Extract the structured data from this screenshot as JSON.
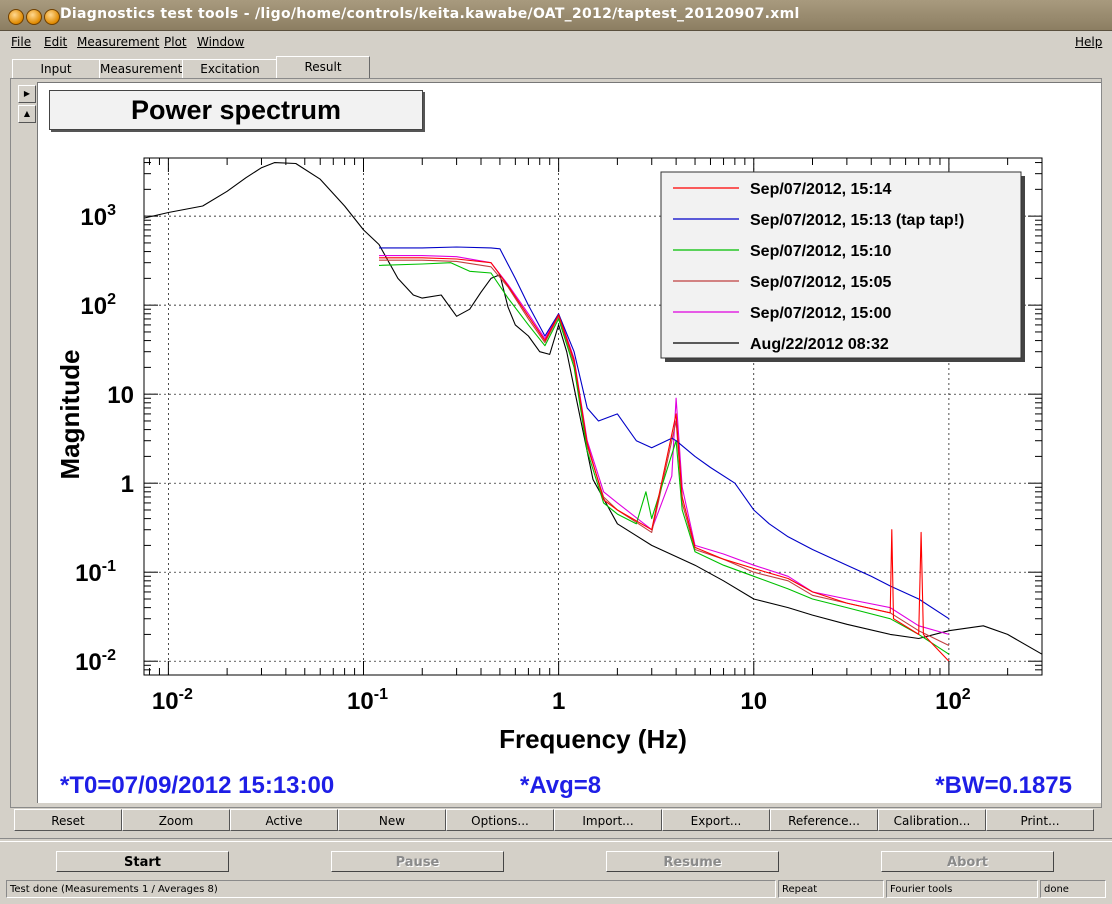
{
  "window": {
    "title": "Diagnostics test tools - /ligo/home/controls/keita.kawabe/OAT_2012/taptest_20120907.xml"
  },
  "menu": {
    "file": "File",
    "edit": "Edit",
    "measurement": "Measurement",
    "plot": "Plot",
    "window": "Window",
    "help": "Help"
  },
  "tabs": [
    "Input",
    "Measurement",
    "Excitation",
    "Result"
  ],
  "active_tab": "Result",
  "plot": {
    "title": "Power spectrum",
    "t0": "*T0=07/09/2012 15:13:00",
    "avg": "*Avg=8",
    "bw": "*BW=0.1875",
    "legend": [
      {
        "label": "Sep/07/2012, 15:14",
        "color": "#ff0000"
      },
      {
        "label": "Sep/07/2012, 15:13 (tap tap!)",
        "color": "#0000c8"
      },
      {
        "label": "Sep/07/2012, 15:10",
        "color": "#00c000"
      },
      {
        "label": "Sep/07/2012, 15:05",
        "color": "#c04040"
      },
      {
        "label": "Sep/07/2012, 15:00",
        "color": "#e000e0"
      },
      {
        "label": "Aug/22/2012 08:32",
        "color": "#000000"
      }
    ]
  },
  "chart_data": {
    "type": "line",
    "title": "Power spectrum",
    "xlabel": "Frequency (Hz)",
    "ylabel": "Magnitude",
    "xscale": "log",
    "yscale": "log",
    "xlim": [
      0.0075,
      300
    ],
    "ylim": [
      0.007,
      4500
    ],
    "grid": true,
    "legend_position": "top-right",
    "x_ticks": [
      {
        "v": 0.01,
        "base": "10",
        "exp": "-2"
      },
      {
        "v": 0.1,
        "base": "10",
        "exp": "-1"
      },
      {
        "v": 1,
        "base": "1",
        "exp": ""
      },
      {
        "v": 10,
        "base": "10",
        "exp": ""
      },
      {
        "v": 100,
        "base": "10",
        "exp": "2"
      }
    ],
    "y_ticks": [
      {
        "v": 0.01,
        "base": "10",
        "exp": "-2"
      },
      {
        "v": 0.1,
        "base": "10",
        "exp": "-1"
      },
      {
        "v": 1,
        "base": "1",
        "exp": ""
      },
      {
        "v": 10,
        "base": "10",
        "exp": ""
      },
      {
        "v": 100,
        "base": "10",
        "exp": "2"
      },
      {
        "v": 1000,
        "base": "10",
        "exp": "3"
      }
    ],
    "series": [
      {
        "name": "Aug/22/2012 08:32",
        "color": "#000000",
        "points": [
          [
            0.0075,
            950
          ],
          [
            0.01,
            1100
          ],
          [
            0.015,
            1300
          ],
          [
            0.02,
            1900
          ],
          [
            0.025,
            2700
          ],
          [
            0.03,
            3500
          ],
          [
            0.035,
            4000
          ],
          [
            0.045,
            3900
          ],
          [
            0.06,
            2600
          ],
          [
            0.08,
            1300
          ],
          [
            0.1,
            700
          ],
          [
            0.12,
            480
          ],
          [
            0.15,
            200
          ],
          [
            0.18,
            130
          ],
          [
            0.2,
            120
          ],
          [
            0.25,
            130
          ],
          [
            0.3,
            75
          ],
          [
            0.35,
            90
          ],
          [
            0.4,
            140
          ],
          [
            0.45,
            200
          ],
          [
            0.5,
            220
          ],
          [
            0.55,
            95
          ],
          [
            0.6,
            60
          ],
          [
            0.7,
            45
          ],
          [
            0.8,
            30
          ],
          [
            0.9,
            28
          ],
          [
            1,
            60
          ],
          [
            1.1,
            30
          ],
          [
            1.3,
            5
          ],
          [
            1.5,
            1.1
          ],
          [
            2,
            0.35
          ],
          [
            3,
            0.2
          ],
          [
            5,
            0.12
          ],
          [
            7,
            0.08
          ],
          [
            10,
            0.05
          ],
          [
            15,
            0.04
          ],
          [
            20,
            0.033
          ],
          [
            30,
            0.026
          ],
          [
            50,
            0.02
          ],
          [
            70,
            0.018
          ],
          [
            100,
            0.022
          ],
          [
            150,
            0.025
          ],
          [
            200,
            0.02
          ],
          [
            300,
            0.012
          ]
        ]
      },
      {
        "name": "Sep/07/2012, 15:00",
        "color": "#e000e0",
        "points": [
          [
            0.12,
            360
          ],
          [
            0.2,
            360
          ],
          [
            0.3,
            350
          ],
          [
            0.45,
            300
          ],
          [
            0.55,
            170
          ],
          [
            0.7,
            80
          ],
          [
            0.85,
            42
          ],
          [
            1,
            80
          ],
          [
            1.2,
            25
          ],
          [
            1.4,
            3
          ],
          [
            1.7,
            0.8
          ],
          [
            2,
            0.6
          ],
          [
            3,
            0.3
          ],
          [
            3.8,
            1.2
          ],
          [
            4,
            9
          ],
          [
            4.3,
            0.9
          ],
          [
            5,
            0.2
          ],
          [
            7,
            0.16
          ],
          [
            10,
            0.12
          ],
          [
            15,
            0.09
          ],
          [
            20,
            0.06
          ],
          [
            30,
            0.05
          ],
          [
            50,
            0.04
          ],
          [
            70,
            0.025
          ],
          [
            100,
            0.02
          ]
        ]
      },
      {
        "name": "Sep/07/2012, 15:05",
        "color": "#c04040",
        "points": [
          [
            0.12,
            320
          ],
          [
            0.2,
            320
          ],
          [
            0.3,
            310
          ],
          [
            0.45,
            270
          ],
          [
            0.55,
            160
          ],
          [
            0.7,
            70
          ],
          [
            0.85,
            38
          ],
          [
            1,
            75
          ],
          [
            1.2,
            22
          ],
          [
            1.4,
            2.6
          ],
          [
            1.7,
            0.7
          ],
          [
            2,
            0.5
          ],
          [
            3,
            0.28
          ],
          [
            4,
            5
          ],
          [
            4.3,
            0.6
          ],
          [
            5,
            0.18
          ],
          [
            7,
            0.14
          ],
          [
            10,
            0.1
          ],
          [
            15,
            0.08
          ],
          [
            20,
            0.055
          ],
          [
            30,
            0.045
          ],
          [
            50,
            0.035
          ],
          [
            70,
            0.022
          ],
          [
            100,
            0.015
          ]
        ]
      },
      {
        "name": "Sep/07/2012, 15:10",
        "color": "#00c000",
        "points": [
          [
            0.12,
            280
          ],
          [
            0.2,
            290
          ],
          [
            0.28,
            300
          ],
          [
            0.35,
            240
          ],
          [
            0.45,
            230
          ],
          [
            0.55,
            120
          ],
          [
            0.7,
            60
          ],
          [
            0.85,
            35
          ],
          [
            1,
            70
          ],
          [
            1.2,
            20
          ],
          [
            1.4,
            2.3
          ],
          [
            1.7,
            0.6
          ],
          [
            2,
            0.45
          ],
          [
            2.5,
            0.35
          ],
          [
            2.8,
            0.8
          ],
          [
            3,
            0.4
          ],
          [
            4,
            3
          ],
          [
            4.3,
            0.5
          ],
          [
            5,
            0.17
          ],
          [
            7,
            0.12
          ],
          [
            10,
            0.09
          ],
          [
            15,
            0.065
          ],
          [
            20,
            0.05
          ],
          [
            30,
            0.04
          ],
          [
            50,
            0.03
          ],
          [
            70,
            0.02
          ],
          [
            100,
            0.012
          ]
        ]
      },
      {
        "name": "Sep/07/2012, 15:13 (tap tap!)",
        "color": "#0000c8",
        "points": [
          [
            0.12,
            440
          ],
          [
            0.2,
            440
          ],
          [
            0.3,
            450
          ],
          [
            0.45,
            440
          ],
          [
            0.5,
            430
          ],
          [
            0.6,
            200
          ],
          [
            0.7,
            100
          ],
          [
            0.85,
            45
          ],
          [
            1,
            80
          ],
          [
            1.2,
            30
          ],
          [
            1.4,
            7
          ],
          [
            1.6,
            5
          ],
          [
            2,
            6
          ],
          [
            2.5,
            3
          ],
          [
            3,
            2.5
          ],
          [
            3.8,
            3.2
          ],
          [
            4,
            3
          ],
          [
            5,
            2
          ],
          [
            6,
            1.5
          ],
          [
            8,
            1
          ],
          [
            10,
            0.5
          ],
          [
            12,
            0.35
          ],
          [
            15,
            0.25
          ],
          [
            20,
            0.18
          ],
          [
            30,
            0.12
          ],
          [
            40,
            0.09
          ],
          [
            50,
            0.07
          ],
          [
            70,
            0.05
          ],
          [
            100,
            0.03
          ]
        ]
      },
      {
        "name": "Sep/07/2012, 15:14",
        "color": "#ff0000",
        "points": [
          [
            0.12,
            340
          ],
          [
            0.2,
            340
          ],
          [
            0.3,
            330
          ],
          [
            0.45,
            300
          ],
          [
            0.55,
            165
          ],
          [
            0.7,
            75
          ],
          [
            0.85,
            40
          ],
          [
            1,
            78
          ],
          [
            1.2,
            24
          ],
          [
            1.4,
            2.8
          ],
          [
            1.7,
            0.65
          ],
          [
            2,
            0.5
          ],
          [
            3,
            0.3
          ],
          [
            4,
            6
          ],
          [
            4.3,
            0.7
          ],
          [
            5,
            0.19
          ],
          [
            7,
            0.14
          ],
          [
            10,
            0.11
          ],
          [
            15,
            0.085
          ],
          [
            20,
            0.06
          ],
          [
            30,
            0.045
          ],
          [
            50,
            0.035
          ],
          [
            51,
            0.3
          ],
          [
            52,
            0.03
          ],
          [
            70,
            0.02
          ],
          [
            72,
            0.28
          ],
          [
            74,
            0.02
          ],
          [
            100,
            0.01
          ]
        ]
      }
    ]
  },
  "toolbar": [
    "Reset",
    "Zoom",
    "Active",
    "New",
    "Options...",
    "Import...",
    "Export...",
    "Reference...",
    "Calibration...",
    "Print..."
  ],
  "controls": {
    "start": "Start",
    "pause": "Pause",
    "resume": "Resume",
    "abort": "Abort"
  },
  "status": {
    "main": "Test done (Measurements 1 / Averages 8)",
    "mode": "Repeat",
    "tool": "Fourier tools",
    "state": "done"
  }
}
